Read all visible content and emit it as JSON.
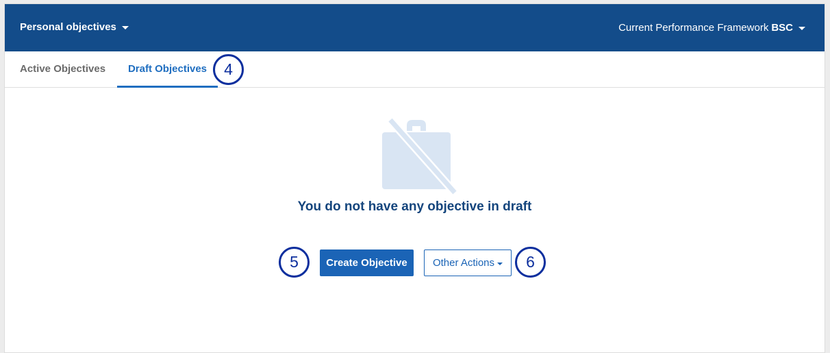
{
  "header": {
    "title": "Personal objectives",
    "framework_label": "Current Performance Framework",
    "framework_value": "BSC"
  },
  "tabs": [
    {
      "label": "Active Objectives",
      "active": false
    },
    {
      "label": "Draft Objectives",
      "active": true
    }
  ],
  "empty_state": {
    "icon": "briefcase-off-icon",
    "message": "You do not have any objective in draft"
  },
  "actions": {
    "create_label": "Create Objective",
    "other_label": "Other Actions"
  },
  "annotations": {
    "tab_marker": "4",
    "create_marker": "5",
    "other_marker": "6"
  },
  "colors": {
    "header_bg": "#134c8a",
    "accent": "#1b64b6",
    "marker": "#0d2f9e",
    "icon_muted": "#d9e5f3"
  }
}
